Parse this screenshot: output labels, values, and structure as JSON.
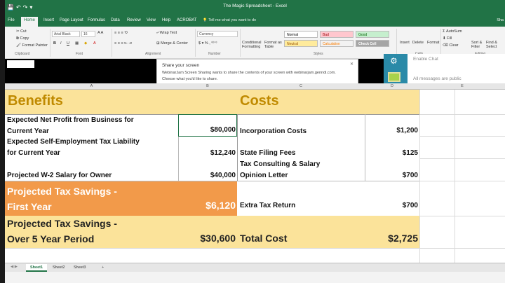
{
  "window": {
    "title": "The Magic Spreadsheet  -  Excel"
  },
  "tabs": [
    "File",
    "Home",
    "Insert",
    "Page Layout",
    "Formulas",
    "Data",
    "Review",
    "View",
    "Help",
    "ACROBAT"
  ],
  "tell_me": "Tell me what you want to do",
  "share": "Sha",
  "ribbon": {
    "cut": "Cut",
    "copy": "Copy",
    "format_painter": "Format Painter",
    "clipboard": "Clipboard",
    "font_name": "Arial Black",
    "font_size": "16",
    "font": "Font",
    "wrap_text": "Wrap Text",
    "merge_center": "Merge & Center",
    "alignment": "Alignment",
    "number_format": "Currency",
    "number": "Number",
    "cond_format": "Conditional Formatting",
    "format_as_table": "Format as Table",
    "style_normal": "Normal",
    "style_bad": "Bad",
    "style_good": "Good",
    "style_neutral": "Neutral",
    "style_calc": "Calculation",
    "style_check": "Check Cell",
    "styles": "Styles",
    "insert": "Insert",
    "delete": "Delete",
    "format": "Format",
    "cells": "Cells",
    "autosum": "AutoSum",
    "fill": "Fill",
    "clear": "Clear",
    "sort_filter": "Sort & Filter",
    "find_select": "Find & Select",
    "editing": "Editing"
  },
  "share_popup": {
    "title": "Share your screen",
    "line1": "WebinarJam Screen Sharing wants to share the contents of your screen with webinarjam.genndi.com.",
    "line2": "Choose what you'd like to share."
  },
  "chat": {
    "enable": "Enable Chat",
    "public": "All messages are public"
  },
  "columns": [
    "A",
    "B",
    "C",
    "D",
    "E"
  ],
  "sheet": {
    "benefits_header": "Benefits",
    "costs_header": "Costs",
    "benefits": [
      {
        "label1": "Expected Net Profit from Business for",
        "label2": "Current Year",
        "value": "$80,000"
      },
      {
        "label1": "Expected Self-Employment Tax Liability",
        "label2": "for Current Year",
        "value": "$12,240"
      },
      {
        "label1": "",
        "label2": "Projected W-2 Salary for Owner",
        "value": "$40,000"
      }
    ],
    "costs": [
      {
        "label1": "",
        "label2": "Incorporation Costs",
        "value": "$1,200"
      },
      {
        "label1": "",
        "label2": "State Filing Fees",
        "value": "$125"
      },
      {
        "label1": "Tax Consulting & Salary",
        "label2": "Opinion Letter",
        "value": "$700"
      }
    ],
    "savings_first": {
      "label1": "Projected Tax Savings -",
      "label2": "First Year",
      "value": "$6,120"
    },
    "extra_tax": {
      "label": "Extra Tax Return",
      "value": "$700"
    },
    "savings_five": {
      "label1": "Projected Tax Savings -",
      "label2": "Over 5 Year Period",
      "value": "$30,600"
    },
    "total_cost": {
      "label": "Total Cost",
      "value": "$2,725"
    }
  },
  "sheet_tabs": [
    "Sheet1",
    "Sheet2",
    "Sheet3"
  ],
  "add_sheet": "+"
}
